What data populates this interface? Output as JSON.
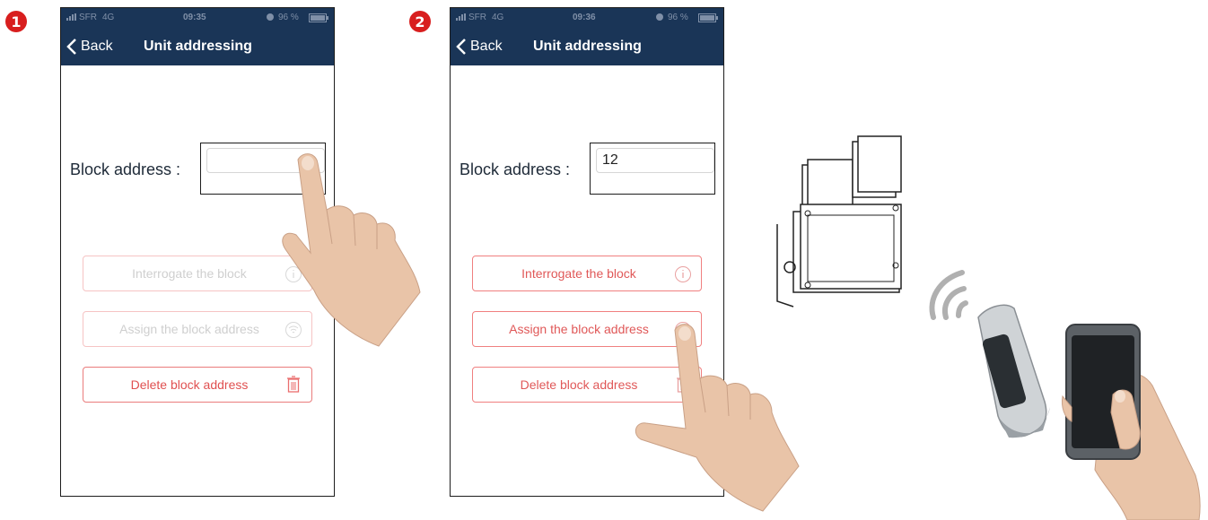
{
  "steps": [
    "1",
    "2"
  ],
  "phone1": {
    "status": {
      "carrier": "SFR",
      "network": "4G",
      "time": "09:35",
      "battery": "96 %"
    },
    "nav": {
      "back_label": "Back",
      "title": "Unit addressing"
    },
    "field": {
      "label": "Block address :",
      "value": ""
    },
    "buttons": {
      "interrogate": "Interrogate the block",
      "assign": "Assign the block address",
      "delete": "Delete block address"
    }
  },
  "phone2": {
    "status": {
      "carrier": "SFR",
      "network": "4G",
      "time": "09:36",
      "battery": "96 %"
    },
    "nav": {
      "back_label": "Back",
      "title": "Unit addressing"
    },
    "field": {
      "label": "Block address :",
      "value": "12"
    },
    "buttons": {
      "interrogate": "Interrogate the block",
      "assign": "Assign the block address",
      "delete": "Delete block address"
    }
  },
  "colors": {
    "header": "#1a3557",
    "accent": "#e05858",
    "badge": "#d81e1e"
  },
  "icons": [
    "chevron-left-icon",
    "info-icon",
    "wifi-icon",
    "trash-icon",
    "signal-icon",
    "alarm-icon",
    "battery-icon"
  ]
}
